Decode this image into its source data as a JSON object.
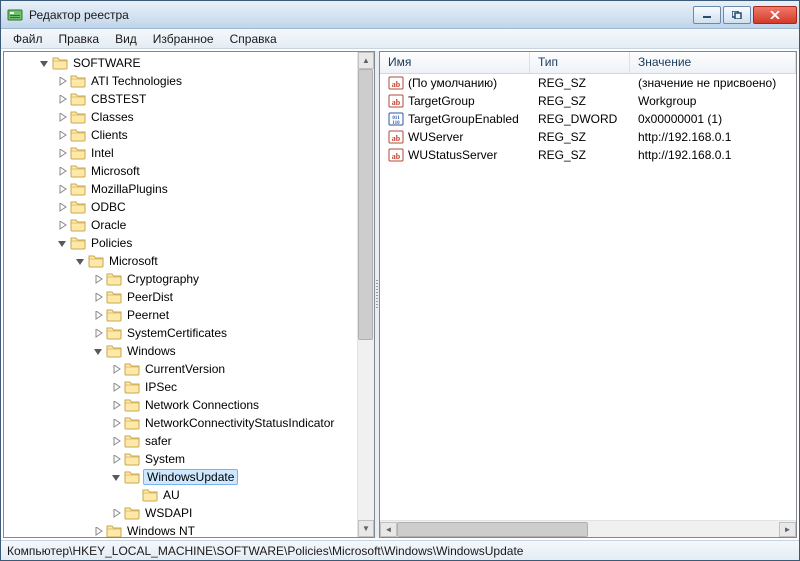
{
  "window": {
    "title": "Редактор реестра"
  },
  "menu": {
    "file": "Файл",
    "edit": "Правка",
    "view": "Вид",
    "favorites": "Избранное",
    "help": "Справка"
  },
  "tree": {
    "software": "SOFTWARE",
    "ati": "ATI Technologies",
    "cbstest": "CBSTEST",
    "classes": "Classes",
    "clients": "Clients",
    "intel": "Intel",
    "microsoft": "Microsoft",
    "mozillaplugins": "MozillaPlugins",
    "odbc": "ODBC",
    "oracle": "Oracle",
    "policies": "Policies",
    "policies_microsoft": "Microsoft",
    "cryptography": "Cryptography",
    "peerdist": "PeerDist",
    "peernet": "Peernet",
    "systemcertificates": "SystemCertificates",
    "windows": "Windows",
    "currentversion": "CurrentVersion",
    "ipsec": "IPSec",
    "networkconnections": "Network Connections",
    "ncsi": "NetworkConnectivityStatusIndicator",
    "safer": "safer",
    "system": "System",
    "windowsupdate": "WindowsUpdate",
    "au": "AU",
    "wsdapi": "WSDAPI",
    "windowsnt": "Windows NT"
  },
  "columns": {
    "name": "Имя",
    "type": "Тип",
    "value": "Значение"
  },
  "values": [
    {
      "icon": "sz",
      "name": "(По умолчанию)",
      "type": "REG_SZ",
      "value": "(значение не присвоено)"
    },
    {
      "icon": "sz",
      "name": "TargetGroup",
      "type": "REG_SZ",
      "value": "Workgroup"
    },
    {
      "icon": "dw",
      "name": "TargetGroupEnabled",
      "type": "REG_DWORD",
      "value": "0x00000001 (1)"
    },
    {
      "icon": "sz",
      "name": "WUServer",
      "type": "REG_SZ",
      "value": "http://192.168.0.1"
    },
    {
      "icon": "sz",
      "name": "WUStatusServer",
      "type": "REG_SZ",
      "value": "http://192.168.0.1"
    }
  ],
  "statusbar": {
    "path": "Компьютер\\HKEY_LOCAL_MACHINE\\SOFTWARE\\Policies\\Microsoft\\Windows\\WindowsUpdate"
  }
}
